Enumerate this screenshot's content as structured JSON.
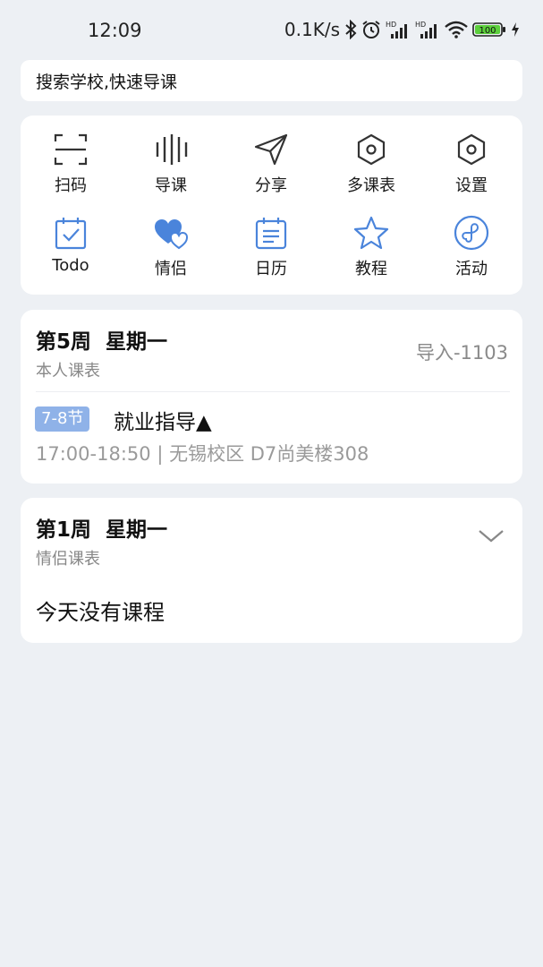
{
  "status_bar": {
    "time": "12:09",
    "net_speed": "0.1K/s",
    "battery": "100",
    "icons": [
      "bluetooth-icon",
      "alarm-icon",
      "hd-signal-icon",
      "hd-signal-icon",
      "wifi-icon",
      "battery-icon",
      "charging-icon"
    ]
  },
  "search": {
    "text": "搜索学校,快速导课"
  },
  "grid": {
    "row1": [
      {
        "label": "扫码",
        "icon": "scan-icon"
      },
      {
        "label": "导课",
        "icon": "import-icon"
      },
      {
        "label": "分享",
        "icon": "share-icon"
      },
      {
        "label": "多课表",
        "icon": "multi-schedule-icon"
      },
      {
        "label": "设置",
        "icon": "settings-icon"
      }
    ],
    "row2": [
      {
        "label": "Todo",
        "icon": "todo-icon"
      },
      {
        "label": "情侣",
        "icon": "couple-icon"
      },
      {
        "label": "日历",
        "icon": "calendar-icon"
      },
      {
        "label": "教程",
        "icon": "tutorial-star-icon"
      },
      {
        "label": "活动",
        "icon": "activity-icon"
      }
    ]
  },
  "my_schedule": {
    "week": "第5周",
    "weekday": "星期一",
    "subtitle": "本人课表",
    "import_label": "导入-1103",
    "course": {
      "period": "7-8节",
      "name": "就业指导▲",
      "time": "17:00-18:50",
      "separator": "|",
      "location": "无锡校区 D7尚美楼308"
    }
  },
  "couple_schedule": {
    "week": "第1周",
    "weekday": "星期一",
    "subtitle": "情侣课表",
    "empty_text": "今天没有课程"
  },
  "colors": {
    "background": "#edf0f4",
    "accent": "#4a84db",
    "badge": "#8fb2e8"
  }
}
